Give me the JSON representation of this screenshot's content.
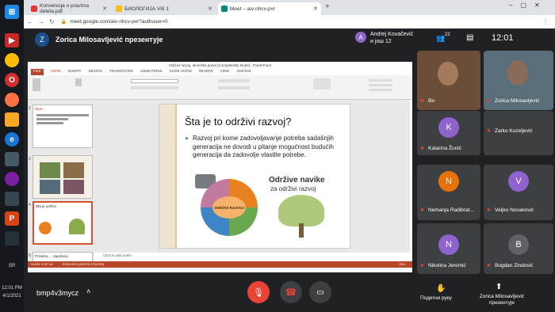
{
  "taskbar": {
    "lang": "SR",
    "time": "12:01 PM",
    "date": "4/1/2021"
  },
  "tabs": [
    {
      "label": "Konvencija o pravima deteta.pdf"
    },
    {
      "label": "БИОЛОГИЈА VIII 1"
    },
    {
      "label": "Meet – aiv-nhcv-pvr"
    }
  ],
  "address": "meet.google.com/aiv-nhcv-pvr?authuser=0",
  "meet": {
    "presenter_initial": "Z",
    "presenter_title": "Zorica Milosavljević презентује",
    "host_initial": "A",
    "host_name": "Andrej Kovačević",
    "host_sub": "и још 12",
    "participant_count": "22",
    "clock": "12:01",
    "code": "bmp4v3mycz",
    "raise_hand": "Подигни руку",
    "presenting_label": "Zorica Milosavljević презентује"
  },
  "ppt": {
    "title": "Održivi razvoj, ekološke prave [Compatibility Mode] - PowerPoint",
    "tabs": [
      "FILE",
      "HOME",
      "INSERT",
      "DESIGN",
      "TRANSITIONS",
      "ANIMATIONS",
      "SLIDE SHOW",
      "REVIEW",
      "VIEW",
      "ADD-INS"
    ],
    "notes": "Click to add notes",
    "slide_status": "SLIDE 4 OF 18",
    "lang_status": "ENGLISH (UNITED STATES)",
    "zoom": "70%"
  },
  "slide": {
    "title": "Šta je to održivi razvoj?",
    "body": "Razvoj pri kome zadovoljavanje potreba sadašnjih generacija ne dovodi u pitanje mogućnost budućih generacija da zadovolje vlastite potrebe.",
    "circle_label": "ODRŽIVI RAZVOJ",
    "tree_title": "Održive navike",
    "tree_sub": "za održivi razvoj"
  },
  "participants": [
    {
      "name": "Ви",
      "initial": "",
      "color": "#7a5a44"
    },
    {
      "name": "Zorica Milosavljević",
      "initial": "",
      "color": "#6d6a5a"
    },
    {
      "name": "Katarina Žunić",
      "initial": "K",
      "color": "#8e63ce"
    },
    {
      "name": "Zarko Kuzeljević",
      "initial": "",
      "color": "#3c4043"
    },
    {
      "name": "Nemanja Radibrat...",
      "initial": "N",
      "color": "#e8710a"
    },
    {
      "name": "Veljko Novaković",
      "initial": "V",
      "color": "#8e63ce"
    },
    {
      "name": "Nikolina Jeremić",
      "initial": "N",
      "color": "#8e63ce"
    },
    {
      "name": "Bogdan Zindović",
      "initial": "B",
      "color": "#5f6368"
    }
  ],
  "thumb_slides": [
    {
      "num": "2",
      "label": "Član..."
    },
    {
      "num": "3",
      "label": ""
    },
    {
      "num": "4",
      "label": "Šta je održivi"
    },
    {
      "num": "5",
      "label": "Privatna ... zajednica"
    }
  ]
}
